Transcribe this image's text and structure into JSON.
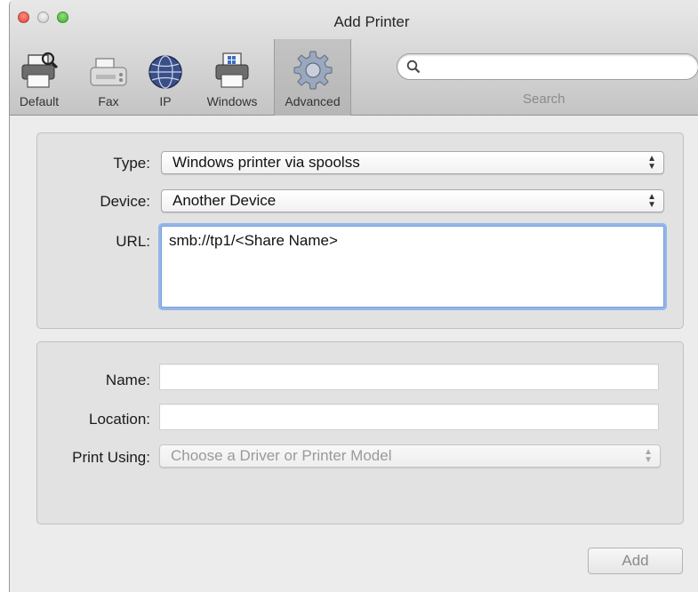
{
  "window": {
    "title": "Add Printer"
  },
  "toolbar": {
    "items": [
      {
        "label": "Default",
        "icon": "printer-search-icon"
      },
      {
        "label": "Fax",
        "icon": "fax-icon"
      },
      {
        "label": "IP",
        "icon": "globe-icon"
      },
      {
        "label": "Windows",
        "icon": "windows-printer-icon"
      },
      {
        "label": "Advanced",
        "icon": "gear-icon",
        "selected": true
      }
    ],
    "search": {
      "value": "",
      "placeholder": "",
      "label": "Search"
    }
  },
  "form": {
    "type_label": "Type:",
    "type_value": "Windows printer via spoolss",
    "device_label": "Device:",
    "device_value": "Another Device",
    "url_label": "URL:",
    "url_value": "smb://tp1/<Share Name>",
    "name_label": "Name:",
    "name_value": "",
    "location_label": "Location:",
    "location_value": "",
    "print_using_label": "Print Using:",
    "print_using_value": "Choose a Driver or Printer Model"
  },
  "actions": {
    "add_label": "Add"
  },
  "colors": {
    "focus_ring": "#93b6e9",
    "close": "#e0443a",
    "zoom": "#3dae2b"
  }
}
